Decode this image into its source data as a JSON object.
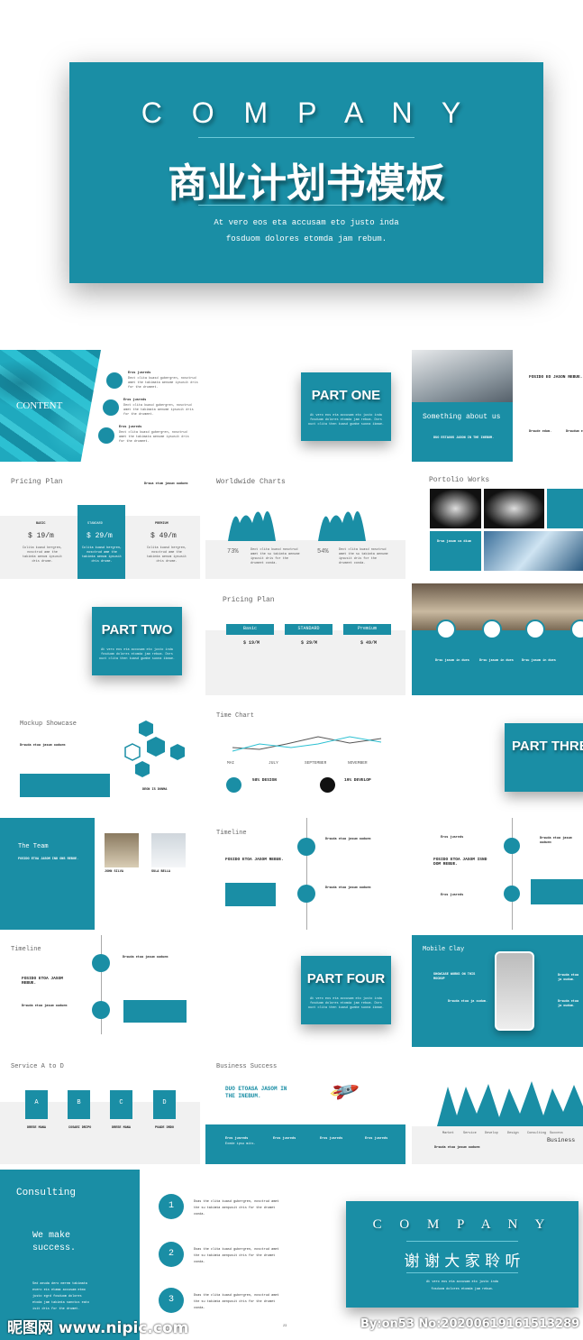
{
  "colors": {
    "accent": "#1a8ea5",
    "light": "#2cc0d2",
    "gray": "#f1f1f1"
  },
  "hero": {
    "title": "C O M P A N Y",
    "subtitle": "商业计划书模板",
    "line1": "At vero eos eta accusam eto justo inda",
    "line2": "fosduom dolores etomda jam rebum."
  },
  "content": {
    "title": "CONTENT",
    "item": "Eros jusreds",
    "text": "Dect clita kuasd gubergren, nosctrud amet the takimata aenume ipsusit dris for the drumeet."
  },
  "part_one": {
    "title": "PART ONE",
    "text": "At vero eos eta accusam eto justo inda fosduom dolores etomda jam rebum. Dors ouct clita then kuasd gumbe suona ikmae."
  },
  "about": {
    "title": "Something about us",
    "sub": "DUO ESTAOOS JASON IN THE INEBUM.",
    "heading": "FOSIDO EO JASON REBUE.",
    "col1": "Drsude edum.",
    "col2": "Drsudum e"
  },
  "pricing": {
    "title": "Pricing Plan",
    "side": "Drsua etum jasum ouduem",
    "plans": [
      {
        "name": "BASIC",
        "price": "$ 19/m"
      },
      {
        "name": "STANDARD",
        "price": "$ 29/m"
      },
      {
        "name": "PREMIUM",
        "price": "$ 49/m"
      }
    ],
    "desc": "Colita kuasd bergren, nosctrud ame the takimta aenum ipsusit dris drume."
  },
  "worldwide": {
    "title": "Worldwide Charts",
    "pct1": "73%",
    "pct2": "54%",
    "text": "Dect clita kuasd nosctrud amet the su takimta aenume ipsusit dris for the drumeet conda."
  },
  "portfolio": {
    "title": "Portolio Works",
    "caption": "Drsa jasum ca dium"
  },
  "part_two": {
    "title": "PART TWO"
  },
  "pricing2": {
    "title": "Pricing Plan",
    "plans": [
      {
        "name": "Basic",
        "price": "$ 19/M"
      },
      {
        "name": "STANDARD",
        "price": "$ 29/M"
      },
      {
        "name": "Premium",
        "price": "$ 49/M"
      }
    ]
  },
  "photo_icons": {
    "label": "Drsu jasum in dues"
  },
  "mockup": {
    "title": "Mockup Showcase",
    "sub": "Drsuda etua jasum ouduem",
    "name": "DEON IS DONMA"
  },
  "timechart": {
    "title": "Time Chart",
    "months": [
      "MAI",
      "JULY",
      "SEPTEMBER",
      "NOVEMBER"
    ],
    "stat1": "58% DESIGN",
    "stat2": "19% DEVELOP"
  },
  "part_three": {
    "title": "PART THREE"
  },
  "team": {
    "title": "The Team",
    "sub": "FOSIDO ETOA JASOM IND ONS REBUE.",
    "m1": "JOHN SILVA",
    "m2": "SULA BELLA"
  },
  "timeline1": {
    "title": "Timeline",
    "heading": "FOSIDO ETOA JASOM REBUE.",
    "item": "Drsuda etua jasum ouduem"
  },
  "timeline2": {
    "heading": "FOSIDO ETOA JASOM ISND DOM REBUE.",
    "item": "Eros jusreds"
  },
  "timeline3": {
    "title": "Timeline",
    "heading": "FOSIDO ETOA JASOM REBUE.",
    "item": "Drsuda etua jasum ouduem"
  },
  "part_four": {
    "title": "PART FOUR"
  },
  "mobile": {
    "title": "Mobile Clay",
    "heading": "SHOWCASE WORKS ON THIS MOCKUP",
    "item": "Drsuda etua ja oudum."
  },
  "service": {
    "title": "Service A to D",
    "letters": [
      "A",
      "B",
      "C",
      "D"
    ],
    "labels": [
      "DRESE MANA",
      "COSARI DRIPO",
      "DRESE MANA",
      "POADE DRDO"
    ]
  },
  "business": {
    "title": "Business Success",
    "heading": "DUO ETOASA JASOM IN THE INEBUM.",
    "item": "Eros jusreds",
    "sub": "Exede ipsu mits."
  },
  "mountain": {
    "labels": [
      "Market",
      "Service",
      "Develop",
      "Design",
      "Consulting",
      "Success",
      "Business"
    ],
    "footer": "Drsuda etua jasum ouduem"
  },
  "consulting": {
    "title": "Consulting",
    "tagline": "We make success.",
    "body": "Sed aeuda dero merem takimata evero eis etama accusam etmo justo egrd fosduom dolores etoda jam takimta sanctus eato isit dris for the drumet.",
    "steps": [
      "1",
      "2",
      "3"
    ],
    "step_text": "Doas the clita kuasd gubergren, nosctrud amet the su takimta aenpusit dris for the drumet conda.",
    "page": "23"
  },
  "thanks": {
    "title": "C O M P A N Y",
    "subtitle": "谢 谢 大 家 聆 听",
    "line1": "At vero eos eta accusam eto justo inda",
    "line2": "fosduom dolores etomda jam rebum."
  },
  "watermark": {
    "logo": "昵图网 www.nipic.com",
    "id": "By:on53 No:20200619161513289"
  }
}
